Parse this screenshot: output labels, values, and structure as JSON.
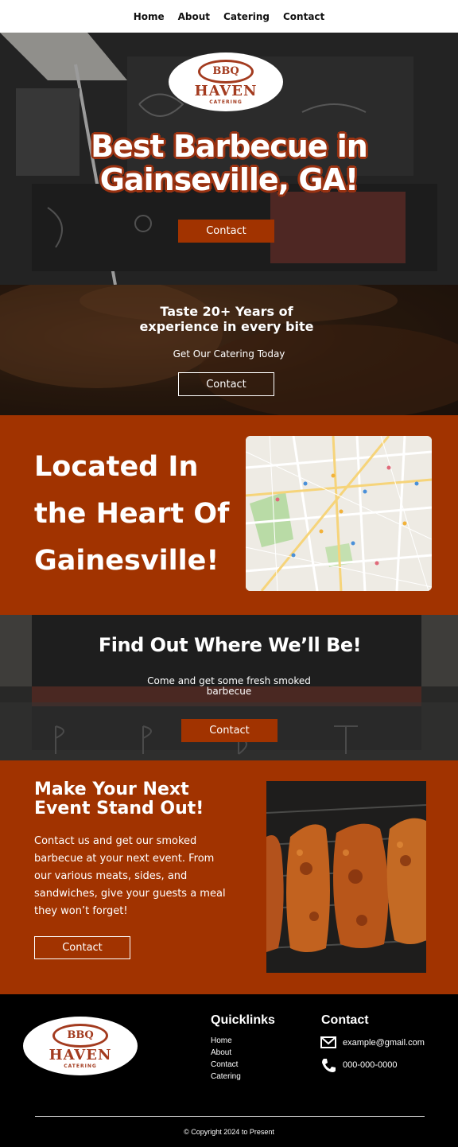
{
  "nav": {
    "items": [
      {
        "label": "Home"
      },
      {
        "label": "About"
      },
      {
        "label": "Catering"
      },
      {
        "label": "Contact"
      }
    ]
  },
  "logo": {
    "badge": "BBQ",
    "name": "HAVEN",
    "tag": "CATERING"
  },
  "hero": {
    "title_line1": "Best Barbecue in",
    "title_line2": "Gainseville, GA!",
    "button": "Contact"
  },
  "taste": {
    "title_line1": "Taste 20+ Years of",
    "title_line2": "experience in every bite",
    "subtitle": "Get Our Catering Today",
    "button": "Contact"
  },
  "located": {
    "line1": "Located In",
    "line2": "the Heart Of",
    "line3": "Gainesville!"
  },
  "find": {
    "title": "Find Out Where We’ll Be!",
    "subtitle": "Come and get some fresh smoked barbecue",
    "button": "Contact"
  },
  "event": {
    "title_line1": "Make Your Next",
    "title_line2": "Event Stand Out!",
    "body": "Contact us and get our smoked barbecue at your next event. From our various meats, sides, and sandwiches, give  your guests a meal they won’t forget!",
    "button": "Contact"
  },
  "footer": {
    "quicklinks_heading": "Quicklinks",
    "quicklinks": [
      {
        "label": "Home"
      },
      {
        "label": "About"
      },
      {
        "label": "Contact"
      },
      {
        "label": "Catering"
      }
    ],
    "contact_heading": "Contact",
    "email": "example@gmail.com",
    "phone": "000-000-0000",
    "copyright": "© Copyright 2024 to Present"
  },
  "colors": {
    "brand": "#a13300",
    "footer_bg": "#000000",
    "logo": "#a33b1f"
  }
}
